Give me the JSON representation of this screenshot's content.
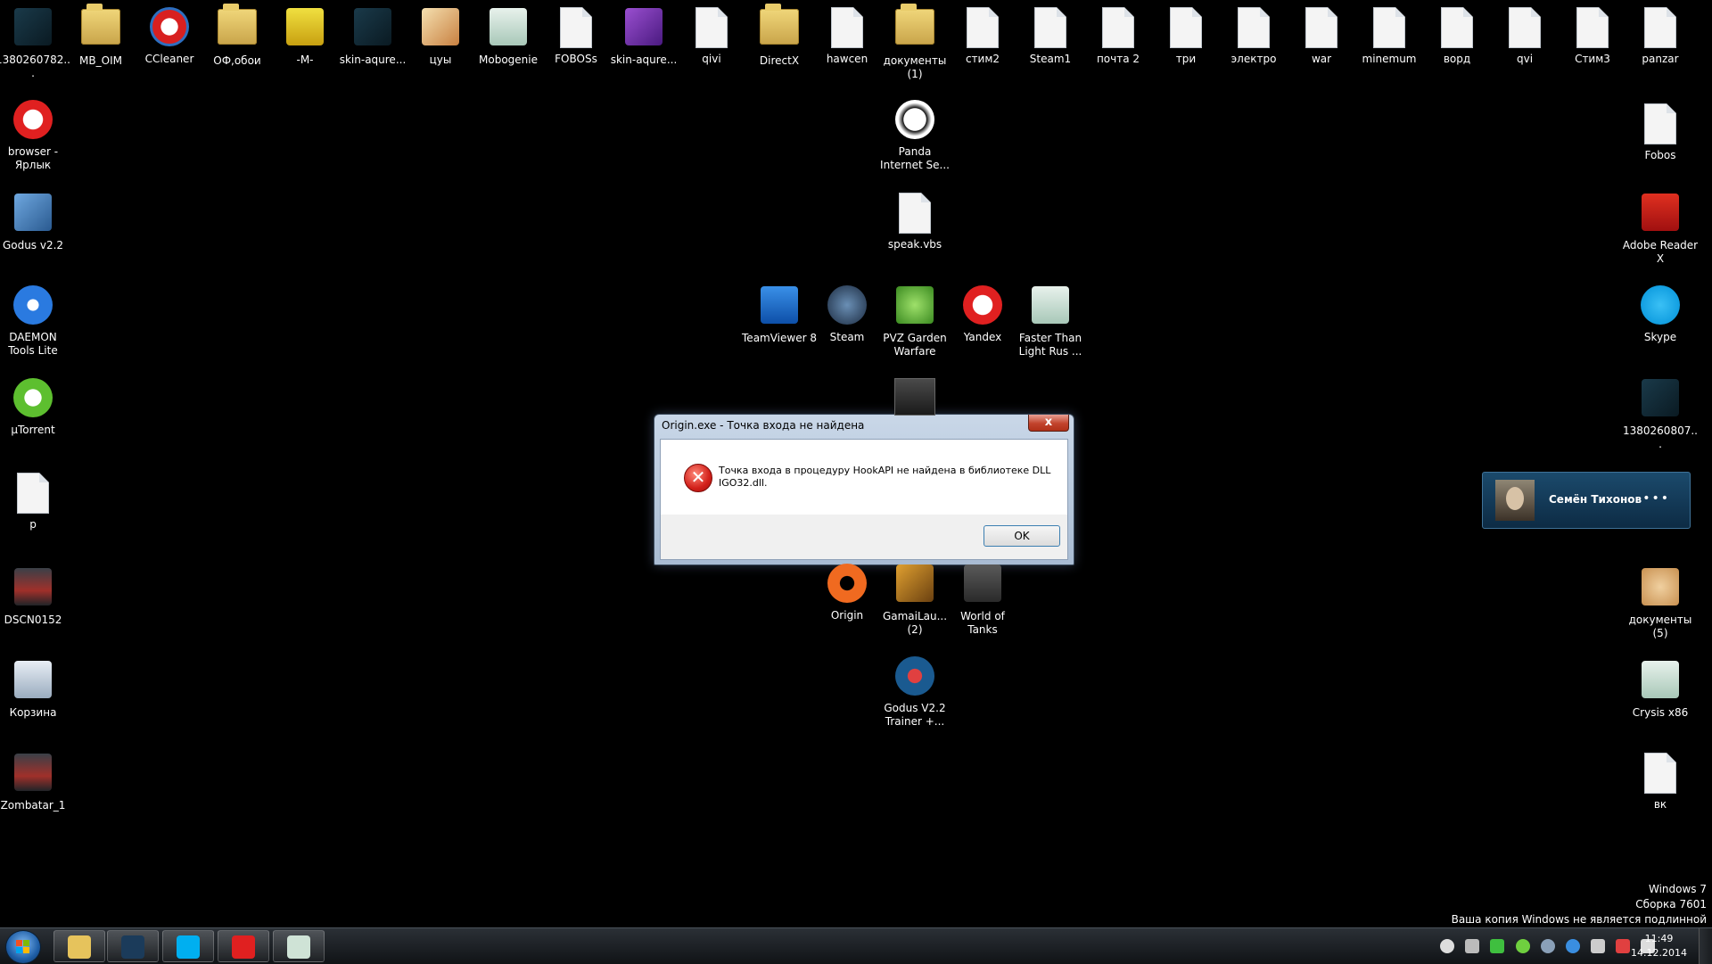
{
  "desktop": {
    "top_row": [
      {
        "label": "1380260782...",
        "icon": "image-thumbnail-icon"
      },
      {
        "label": "MB_OIM",
        "icon": "folder-icon"
      },
      {
        "label": "CCleaner",
        "icon": "ccleaner-icon"
      },
      {
        "label": "ОФ,обои",
        "icon": "folder-icon"
      },
      {
        "label": "-M-",
        "icon": "shield-warning-icon"
      },
      {
        "label": "skin-aqure...",
        "icon": "image-thumbnail-icon"
      },
      {
        "label": "цуы",
        "icon": "paint-icon"
      },
      {
        "label": "Mobogenie",
        "icon": "app-window-icon"
      },
      {
        "label": "FOBOSs",
        "icon": "file-icon"
      },
      {
        "label": "skin-aqure...",
        "icon": "rar-archive-icon"
      },
      {
        "label": "qivi",
        "icon": "file-icon"
      },
      {
        "label": "DirectX",
        "icon": "folder-icon"
      },
      {
        "label": "hawcen",
        "icon": "file-icon"
      },
      {
        "label": "документы (1)",
        "icon": "folder-icon"
      },
      {
        "label": "стим2",
        "icon": "file-icon"
      },
      {
        "label": "Steam1",
        "icon": "file-icon"
      },
      {
        "label": "почта 2",
        "icon": "file-icon"
      },
      {
        "label": "три",
        "icon": "file-icon"
      },
      {
        "label": "электро",
        "icon": "file-icon"
      },
      {
        "label": "war",
        "icon": "file-icon"
      },
      {
        "label": "minemum",
        "icon": "file-icon"
      },
      {
        "label": "ворд",
        "icon": "file-icon"
      },
      {
        "label": "qvi",
        "icon": "file-icon"
      },
      {
        "label": "Стим3",
        "icon": "file-icon"
      },
      {
        "label": "panzar",
        "icon": "file-icon"
      }
    ],
    "left_column": [
      {
        "label": "browser - Ярлык",
        "icon": "yandex-browser-icon"
      },
      {
        "label": "Godus v2.2",
        "icon": "installer-icon"
      },
      {
        "label": "DAEMON Tools Lite",
        "icon": "daemon-tools-icon"
      },
      {
        "label": "µTorrent",
        "icon": "utorrent-icon"
      },
      {
        "label": "p",
        "icon": "file-icon"
      },
      {
        "label": "DSCN0152",
        "icon": "photo-thumbnail-icon"
      },
      {
        "label": "Корзина",
        "icon": "recycle-bin-icon"
      },
      {
        "label": "Zombatar_1",
        "icon": "photo-thumbnail-icon"
      }
    ],
    "right_column": [
      {
        "label": "Fobos",
        "icon": "file-icon"
      },
      {
        "label": "Adobe Reader X",
        "icon": "adobe-reader-icon"
      },
      {
        "label": "Skype",
        "icon": "skype-icon"
      },
      {
        "label": "1380260807...",
        "icon": "image-thumbnail-icon"
      },
      {
        "label": "документы (5)",
        "icon": "paint-palette-icon"
      },
      {
        "label": "Crysis x86",
        "icon": "app-window-icon"
      },
      {
        "label": "вк",
        "icon": "file-icon"
      }
    ],
    "middle": [
      {
        "label": "Panda Internet Se...",
        "icon": "panda-icon"
      },
      {
        "label": "speak.vbs",
        "icon": "file-icon"
      },
      {
        "label": "TeamViewer 8",
        "icon": "teamviewer-icon"
      },
      {
        "label": "Steam",
        "icon": "steam-icon"
      },
      {
        "label": "PVZ Garden Warfare",
        "icon": "pvz-icon"
      },
      {
        "label": "Yandex",
        "icon": "yandex-browser-icon"
      },
      {
        "label": "Faster Than Light Rus ...",
        "icon": "app-window-icon"
      },
      {
        "label": "Origin",
        "icon": "origin-icon"
      },
      {
        "label": "GamaiLau... (2)",
        "icon": "game-launcher-icon"
      },
      {
        "label": "World of Tanks",
        "icon": "world-of-tanks-icon"
      },
      {
        "label": "Godus V2.2 Trainer +...",
        "icon": "trainer-icon"
      }
    ]
  },
  "dialog": {
    "title": "Origin.exe - Точка входа не найдена",
    "close_label": "x",
    "message": "Точка входа в процедуру HookAPI не найдена в библиотеке DLL IGO32.dll.",
    "ok_label": "OK",
    "icon": "error-icon"
  },
  "notification": {
    "name": "Семён Тихонов",
    "more_label": "•••"
  },
  "watermark": {
    "line1": "Windows 7",
    "line2": "Сборка 7601",
    "line3": "Ваша копия Windows не является подлинной"
  },
  "taskbar": {
    "pinned": [
      {
        "name": "explorer",
        "icon": "folder-icon",
        "color": "#e6c35c"
      },
      {
        "name": "steam",
        "icon": "steam-icon",
        "color": "#1b3b5a"
      },
      {
        "name": "skype",
        "icon": "skype-icon",
        "color": "#00aff0"
      },
      {
        "name": "yandex",
        "icon": "yandex-browser-icon",
        "color": "#e02020"
      },
      {
        "name": "app",
        "icon": "app-window-icon",
        "color": "#cfe3d6"
      }
    ],
    "clock_time": "11:49",
    "clock_date": "14.12.2014"
  }
}
